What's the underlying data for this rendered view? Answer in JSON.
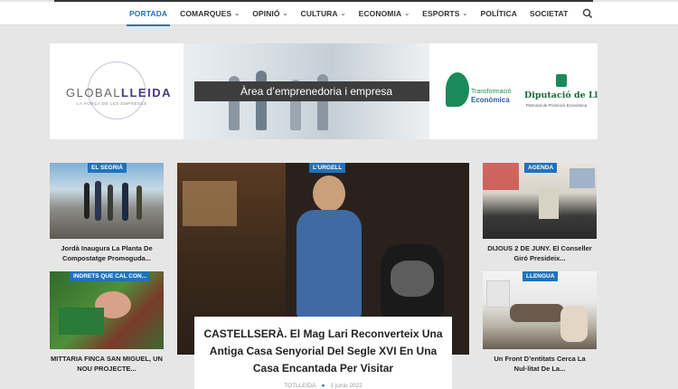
{
  "nav": {
    "items": [
      {
        "label": "PORTADA",
        "dropdown": false,
        "active": true
      },
      {
        "label": "COMARQUES",
        "dropdown": true
      },
      {
        "label": "OPINIÓ",
        "dropdown": true
      },
      {
        "label": "CULTURA",
        "dropdown": true
      },
      {
        "label": "ECONOMIA",
        "dropdown": true
      },
      {
        "label": "ESPORTS",
        "dropdown": true
      },
      {
        "label": "POLÍTICA",
        "dropdown": false
      },
      {
        "label": "SOCIETAT",
        "dropdown": false
      }
    ],
    "search_icon": "search-icon"
  },
  "banner": {
    "brand_a": "GLOBAL",
    "brand_b": "LLEIDA",
    "brand_sub": "LA FORÇA DE LES EMPRESES",
    "headline": "Àrea d’emprenedoria i empresa",
    "partner1_line1": "Transformació",
    "partner1_line2": "Econòmica",
    "partner2_name": "Diputació de Lleida",
    "partner2_sub": "Patronat de Promoció Econòmica"
  },
  "cards": [
    {
      "category": "EL SEGRIÀ",
      "title": "Jordà Inaugura La Planta De Compostatge Promoguda..."
    },
    {
      "category": "INDRETS QUE CAL CON...",
      "title": "MITTARIA FINCA SAN MIGUEL, UN NOU PROJECTE..."
    },
    {
      "category": "AGENDA",
      "title": "DIJOUS 2 DE JUNY. El Conseller Giró Presideix..."
    },
    {
      "category": "LLENGUA",
      "title": "Un Front D’entitats Cerca La Nul·litat De La..."
    }
  ],
  "featured": {
    "category": "L'URGELL",
    "title": "CASTELLSERÀ. El Mag Lari Reconverteix Una Antiga Casa Senyorial Del Segle XVI En Una Casa Encantada Per Visitar",
    "author": "TOTLLEIDA",
    "date": "1 junio 2022"
  },
  "colors": {
    "accent": "#1e73be",
    "nav_text": "#333333",
    "page_bg": "#e6e6e6"
  }
}
